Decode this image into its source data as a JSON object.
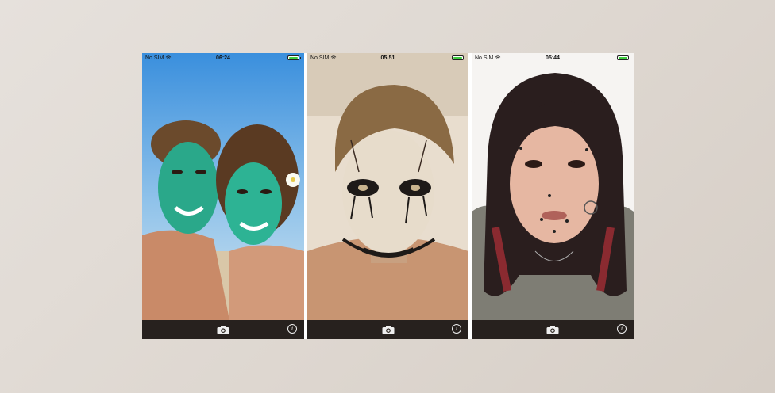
{
  "screens": [
    {
      "carrier": "No SIM",
      "time": "06:24"
    },
    {
      "carrier": "No SIM",
      "time": "05:51"
    },
    {
      "carrier": "No SIM",
      "time": "05:44"
    }
  ],
  "icons": {
    "camera": "camera-icon",
    "info": "info-icon",
    "wifi": "wifi-icon",
    "battery": "battery-icon"
  },
  "colors": {
    "background": "#e0dad4",
    "toolbar": "#2b241f",
    "battery_fill": "#3fcf3f",
    "face_paint_green": "#2aa88a"
  },
  "toolbar": {
    "info_glyph": "i"
  }
}
